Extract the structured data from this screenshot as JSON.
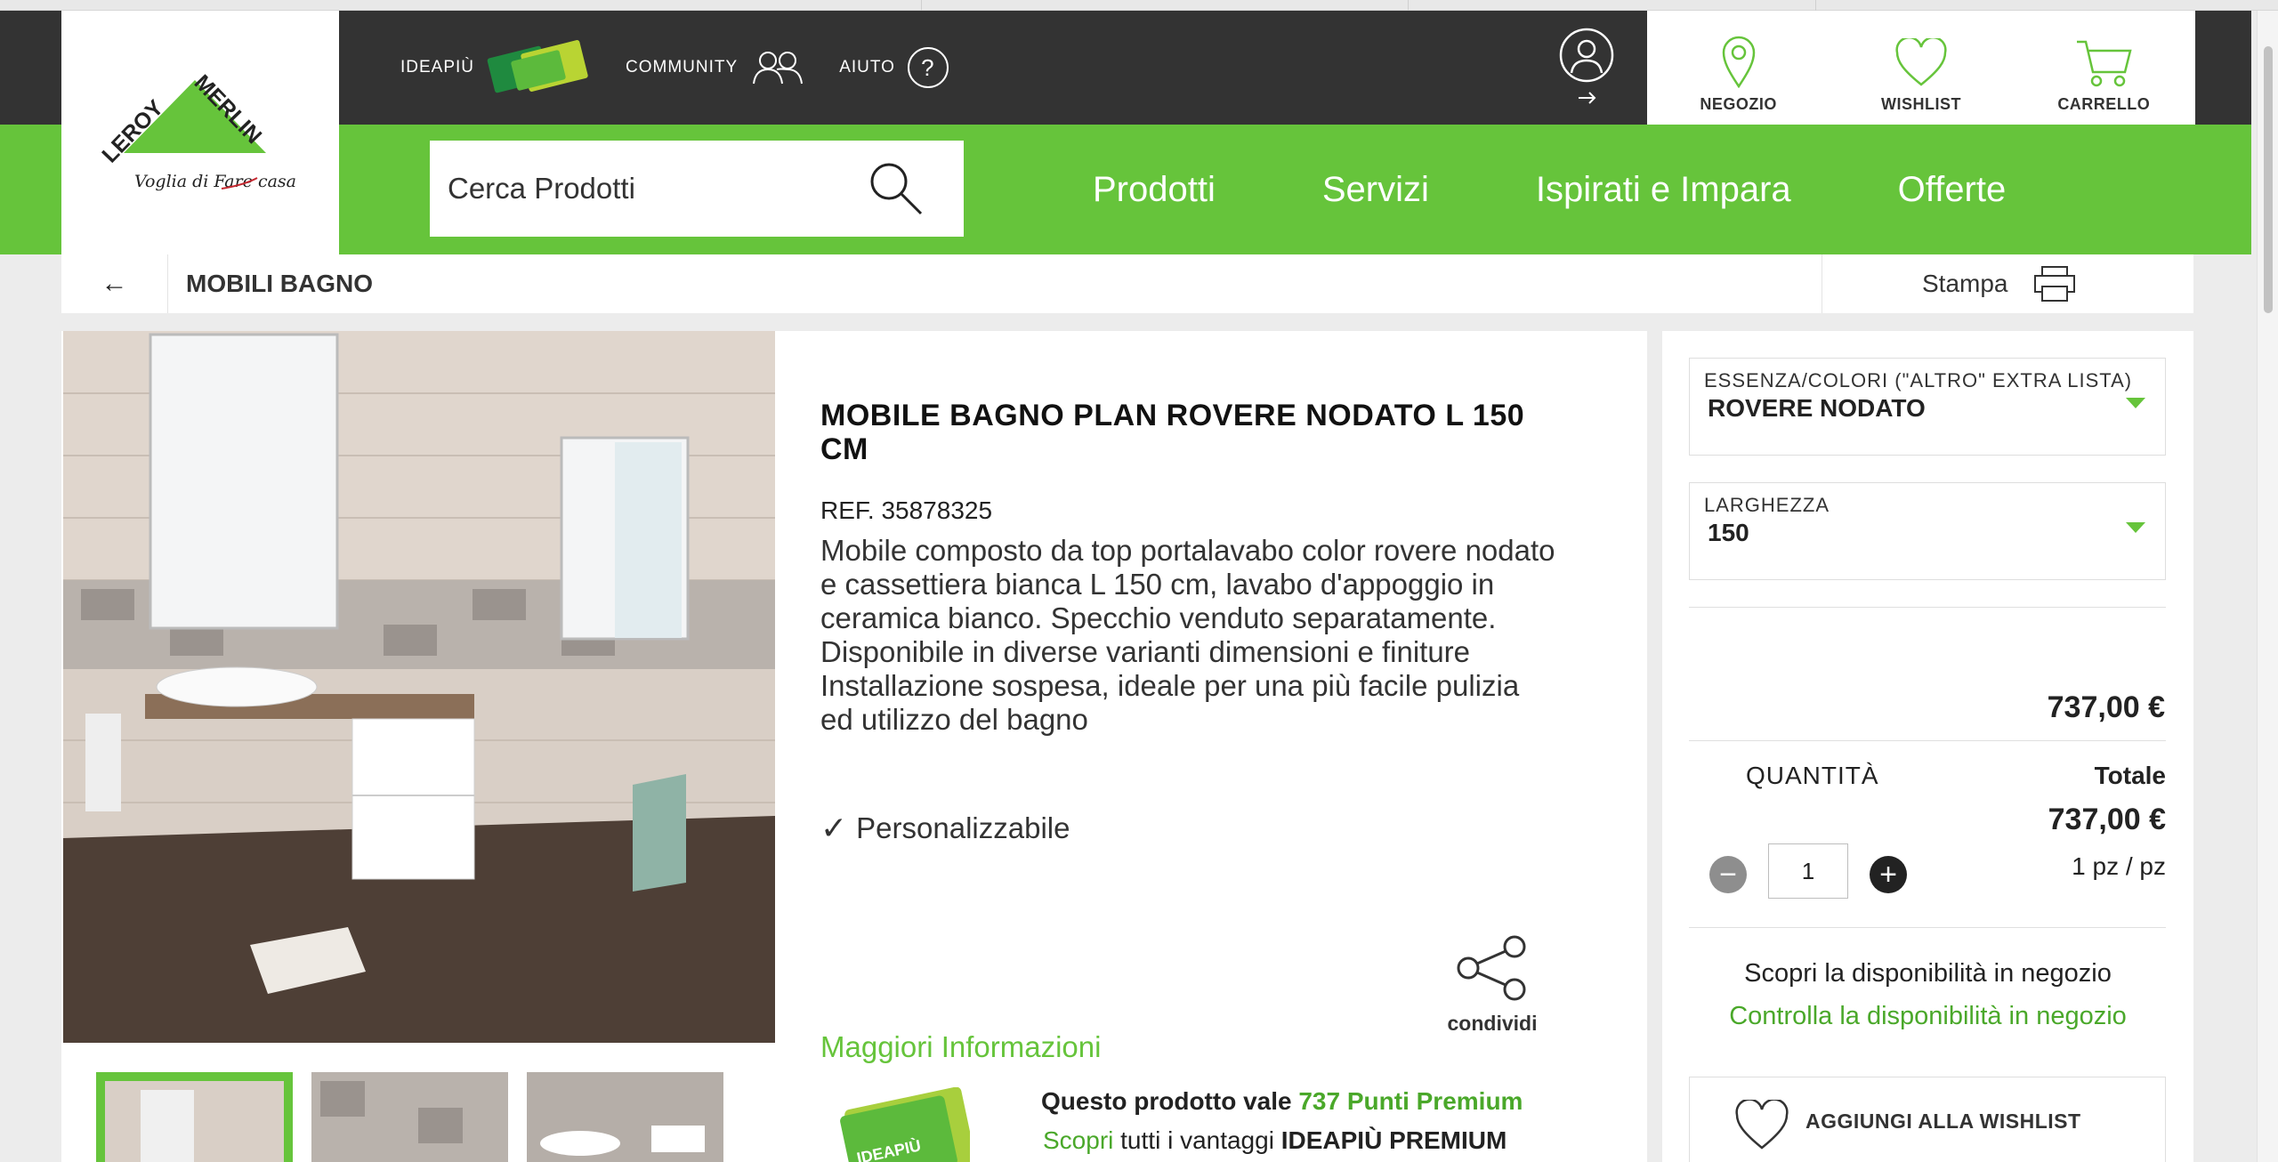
{
  "header": {
    "logo_text": "LEROY MERLIN",
    "logo_tagline": "Voglia di Fare casa",
    "top_links": [
      {
        "label": "IDEAPIÙ",
        "icon": "ideapiu-card-icon"
      },
      {
        "label": "COMMUNITY",
        "icon": "community-people-icon"
      },
      {
        "label": "AIUTO",
        "icon": "help-icon"
      }
    ],
    "utility": [
      {
        "label": "NEGOZIO",
        "icon": "location-pin-icon"
      },
      {
        "label": "WISHLIST",
        "icon": "heart-icon"
      },
      {
        "label": "CARRELLO",
        "icon": "cart-icon"
      }
    ],
    "search_placeholder": "Cerca Prodotti",
    "nav": [
      "Prodotti",
      "Servizi",
      "Ispirati e Impara",
      "Offerte"
    ]
  },
  "breadcrumb": {
    "title": "MOBILI BAGNO",
    "print_label": "Stampa"
  },
  "product": {
    "title": "MOBILE BAGNO PLAN ROVERE NODATO L 150 CM",
    "ref": "REF. 35878325",
    "description": "Mobile composto da top portalavabo color rovere nodato e cassettiera bianca L 150 cm, lavabo d'appoggio in ceramica bianco. Specchio venduto separatamente. Disponibile in diverse varianti dimensioni e finiture",
    "description2": "Installazione sospesa, ideale per una più facile pulizia ed utilizzo del bagno",
    "feature": "Personalizzabile",
    "share_label": "condividi",
    "more_info": "Maggiori Informazioni",
    "promo": {
      "line1_prefix": "Questo prodotto vale ",
      "line1_points": "737 Punti Premium",
      "line2_link": "Scopri",
      "line2_mid": " tutti i vantaggi ",
      "line2_bold": "IDEAPIÙ PREMIUM",
      "card_text": "IDEAPIÙ"
    }
  },
  "purchase": {
    "option1_label": "ESSENZA/COLORI (\"ALTRO\" EXTRA LISTA)",
    "option1_value": "ROVERE NODATO",
    "option2_label": "LARGHEZZA",
    "option2_value": "150",
    "price": "737,00 €",
    "quantity_label": "QUANTITÀ",
    "total_label": "Totale",
    "total_value": "737,00 €",
    "unit": "1 pz / pz",
    "quantity_value": "1",
    "minus_symbol": "−",
    "plus_symbol": "+",
    "availability_text": "Scopri la disponibilità in negozio",
    "availability_link": "Controlla la disponibilità in negozio",
    "wishlist_button": "AGGIUNGI ALLA WISHLIST"
  },
  "colors": {
    "brand_green": "#66c43b",
    "dark_header": "#333333",
    "link_green": "#4aa82a"
  }
}
